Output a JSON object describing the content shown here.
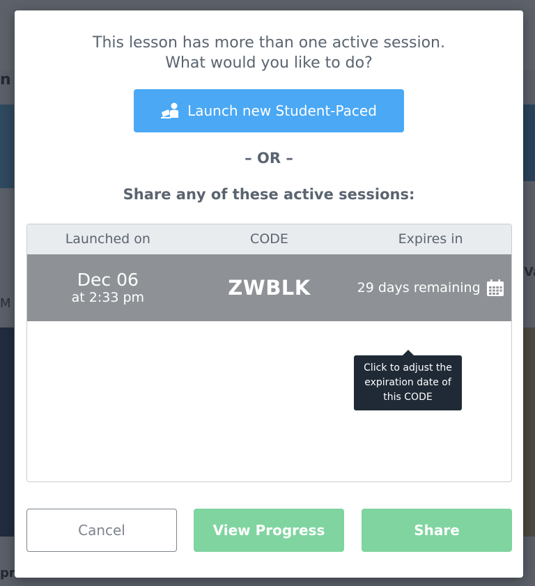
{
  "background": {
    "title_fragment": "n f",
    "left_fragment": "M",
    "right_fragment": "Va",
    "bottom_fragment": "pr"
  },
  "dialog": {
    "prompt_line1": "This lesson has more than one active session.",
    "prompt_line2": "What would you like to do?",
    "launch_button": {
      "label": "Launch new Student-Paced",
      "icon": "student-paced-icon"
    },
    "or_divider": "– OR –",
    "share_heading": "Share any of these active sessions:",
    "table": {
      "headers": [
        "Launched on",
        "CODE",
        "Expires in"
      ],
      "rows": [
        {
          "date": "Dec 06",
          "time": "at 2:33 pm",
          "code": "ZWBLK",
          "expires": "29 days remaining",
          "icon": "calendar-icon"
        }
      ]
    },
    "tooltip": {
      "line1": "Click to adjust the",
      "line2": "expiration date of",
      "line3": "this CODE"
    },
    "buttons": {
      "cancel": "Cancel",
      "view_progress": "View Progress",
      "share": "Share"
    }
  },
  "colors": {
    "primary_blue": "#4aa8f5",
    "success_green": "#7fd4a0",
    "selected_row": "#8e9296",
    "tooltip_bg": "#1f2a36",
    "text_muted": "#5a6470"
  }
}
